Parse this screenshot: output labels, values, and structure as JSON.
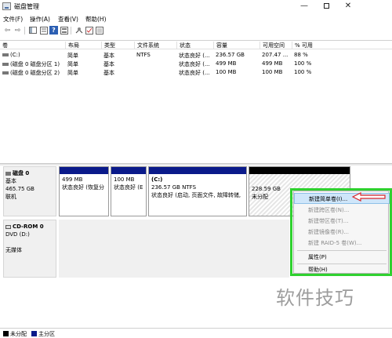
{
  "window": {
    "title": "磁盘管理",
    "minimize": "—",
    "close": "✕"
  },
  "menu": [
    "文件(F)",
    "操作(A)",
    "查看(V)",
    "帮助(H)"
  ],
  "toolbar": {
    "back": "⇦",
    "forward": "⇨",
    "help": "?",
    "icons": [
      "back-icon",
      "forward-icon",
      "properties-icon",
      "help-icon",
      "connect-icon",
      "check-icon",
      "settings-icon"
    ]
  },
  "volume_list": {
    "headers": [
      "卷",
      "布局",
      "类型",
      "文件系统",
      "状态",
      "容量",
      "可用空间",
      "% 可用"
    ],
    "rows": [
      [
        "(C:)",
        "简单",
        "基本",
        "NTFS",
        "状态良好 (...",
        "236.57 GB",
        "207.47 ...",
        "88 %"
      ],
      [
        "(磁盘 0 磁盘分区 1)",
        "简单",
        "基本",
        "",
        "状态良好 (...",
        "499 MB",
        "499 MB",
        "100 %"
      ],
      [
        "(磁盘 0 磁盘分区 2)",
        "简单",
        "基本",
        "",
        "状态良好 (...",
        "100 MB",
        "100 MB",
        "100 %"
      ]
    ]
  },
  "disks": {
    "disk0": {
      "name": "磁盘 0",
      "type": "基本",
      "size": "465.75 GB",
      "status": "联机",
      "partitions": [
        {
          "size": "499 MB",
          "status": "状态良好 (恢复分"
        },
        {
          "size": "100 MB",
          "status": "状态良好 (E"
        },
        {
          "label": "(C:)",
          "size": "236.57 GB NTFS",
          "status": "状态良好 (启动, 页面文件, 故障转储,"
        },
        {
          "size": "228.59 GB",
          "status": "未分配"
        }
      ]
    },
    "cdrom0": {
      "name": "CD-ROM 0",
      "type": "DVD (D:)",
      "status": "无媒体"
    }
  },
  "context_menu": {
    "items": [
      {
        "label": "新建简单卷(I)...",
        "enabled": true
      },
      {
        "label": "新建跨区卷(N)...",
        "enabled": false
      },
      {
        "label": "新建带区卷(T)...",
        "enabled": false
      },
      {
        "label": "新建镜像卷(R)...",
        "enabled": false
      },
      {
        "label": "新建 RAID-5 卷(W)...",
        "enabled": false
      },
      {
        "label": "属性(P)",
        "enabled": true
      },
      {
        "label": "帮助(H)",
        "enabled": true
      }
    ]
  },
  "legend": [
    {
      "label": "未分配",
      "color": "#000000"
    },
    {
      "label": "主分区",
      "color": "#0a1a8a"
    }
  ],
  "watermark": "软件技巧",
  "colors": {
    "highlight": "#2fd12f",
    "primary_partition": "#0a1a8a",
    "arrow": "#d9252a"
  }
}
